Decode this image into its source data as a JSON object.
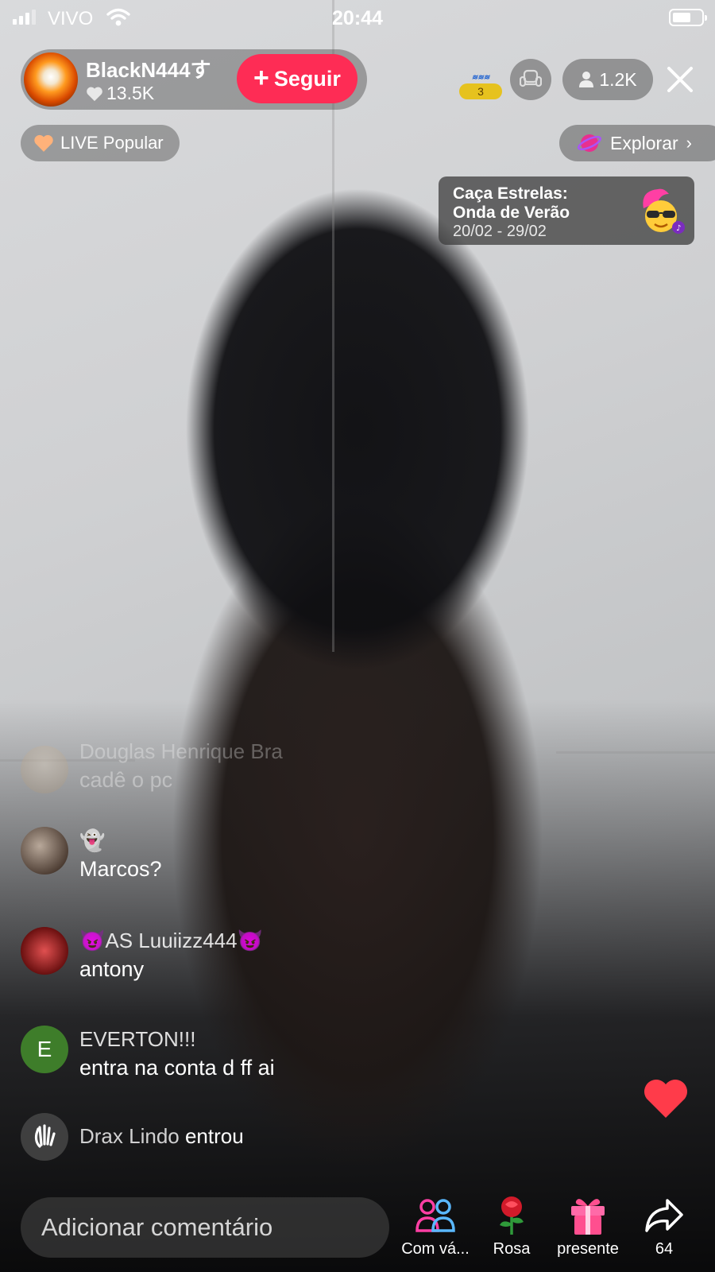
{
  "status_bar": {
    "carrier": "VIVO",
    "time": "20:44"
  },
  "host": {
    "name": "BlackN444す",
    "likes": "13.5K",
    "follow_label": "Seguir"
  },
  "top_right": {
    "rank_number": "3",
    "viewer_count": "1.2K"
  },
  "live_popular_label": "LIVE Popular",
  "explore_label": "Explorar",
  "event": {
    "title": "Caça Estrelas:\nOnda de Verão",
    "dates": "20/02 - 29/02"
  },
  "comments": [
    {
      "user": "Douglas Henrique Bra",
      "text": "cadê  o pc"
    },
    {
      "user": "👻",
      "text": "Marcos?"
    },
    {
      "user": "😈AS Luuiizz444😈",
      "text": "antony"
    },
    {
      "user": "EVERTON!!!",
      "text": "entra na conta d ff ai",
      "avatar_letter": "E"
    }
  ],
  "join_notice": {
    "user": "Drax Lindo",
    "action": "entrou"
  },
  "bottom_bar": {
    "comment_placeholder": "Adicionar comentário",
    "actions": [
      {
        "label": "Com vá...",
        "icon": "multi-guest-icon"
      },
      {
        "label": "Rosa",
        "icon": "rose-icon"
      },
      {
        "label": "presente",
        "icon": "gift-icon"
      },
      {
        "label": "64",
        "icon": "share-icon"
      }
    ]
  },
  "colors": {
    "accent": "#fe2c55",
    "heart": "#ff3b4a",
    "everton_avatar": "#3e7d2a"
  }
}
